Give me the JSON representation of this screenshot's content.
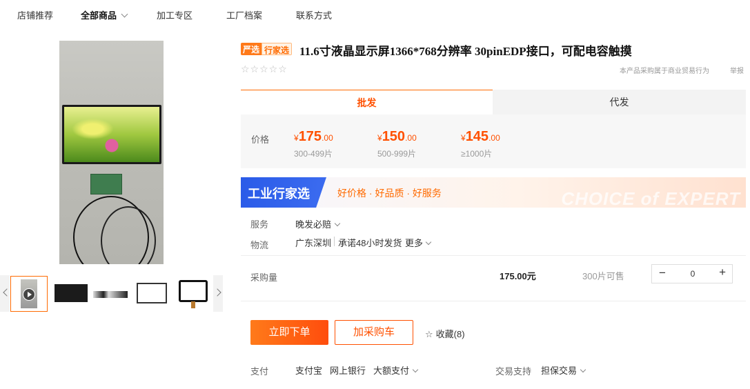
{
  "nav": {
    "items": [
      "店铺推荐",
      "全部商品",
      "加工专区",
      "工厂档案",
      "联系方式"
    ]
  },
  "product": {
    "badge_primary": "严选",
    "badge_secondary": "行家选",
    "title": "11.6寸液晶显示屏1366*768分辨率 30pinEDP接口，可配电容触摸",
    "rating_stars": "☆☆☆☆☆",
    "policy_text": "本产品采购属于商业贸易行为",
    "report_link": "举报"
  },
  "tabs": [
    "批发",
    "代发"
  ],
  "price": {
    "label": "价格",
    "tiers": [
      {
        "yen": "¥",
        "whole": "175",
        "decimal": ".00",
        "range": "300-499片"
      },
      {
        "yen": "¥",
        "whole": "150",
        "decimal": ".00",
        "range": "500-999片"
      },
      {
        "yen": "¥",
        "whole": "145",
        "decimal": ".00",
        "range": "≥1000片"
      }
    ]
  },
  "banner": {
    "title": "工业行家选",
    "tags": "好价格 · 好品质 · 好服务",
    "english": "CHOICE of EXPERT"
  },
  "service": {
    "label": "服务",
    "value": "晚发必赔"
  },
  "logistics": {
    "label": "物流",
    "origin": "广东深圳",
    "promise": "承诺48小时发货",
    "more": "更多"
  },
  "purchase": {
    "label": "采购量",
    "total": "175.00元",
    "stock": "300片可售",
    "minus": "−",
    "plus": "+",
    "quantity": "0"
  },
  "actions": {
    "buy_now": "立即下单",
    "add_cart": "加采购车",
    "favorite": "收藏(8)"
  },
  "payment": {
    "label": "支付",
    "methods": [
      "支付宝",
      "网上银行",
      "大额支付"
    ],
    "trade_label": "交易支持",
    "trade_value": "担保交易"
  },
  "colors": {
    "accent": "#ff5000",
    "badge": "#ff7a1a",
    "banner_blue": "#2a5be8"
  }
}
